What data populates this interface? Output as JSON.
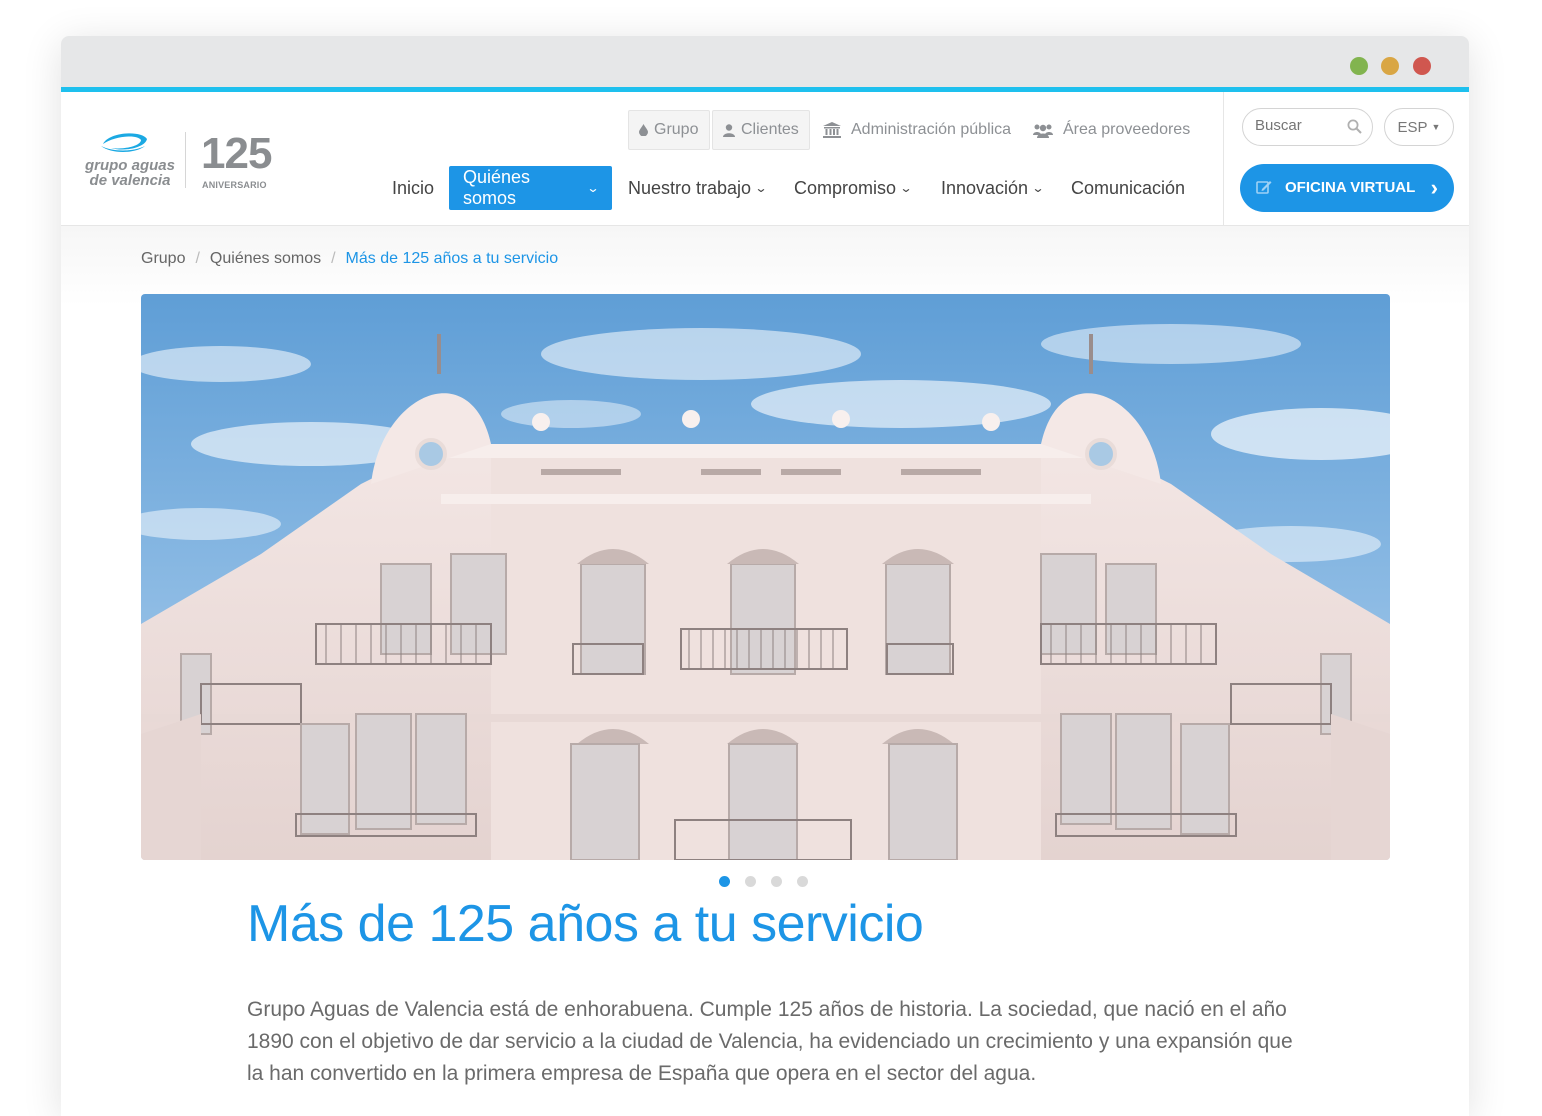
{
  "window": {
    "controls": [
      {
        "name": "minimize",
        "color": "#82b44f"
      },
      {
        "name": "zoom",
        "color": "#d9a644"
      },
      {
        "name": "close",
        "color": "#d0574f"
      }
    ]
  },
  "logo": {
    "line1": "grupo aguas",
    "line2": "de valencia",
    "anniversary_number": "125",
    "anniversary_label": "ANIVERSARIO"
  },
  "top_links": [
    {
      "label": "Grupo",
      "icon": "drop-icon"
    },
    {
      "label": "Clientes",
      "icon": "user-icon"
    },
    {
      "label": "Administración pública",
      "icon": "bank-icon"
    },
    {
      "label": "Área proveedores",
      "icon": "users-icon"
    }
  ],
  "main_nav": [
    {
      "label": "Inicio",
      "has_dropdown": false,
      "active": false
    },
    {
      "label": "Quiénes somos",
      "has_dropdown": true,
      "active": true
    },
    {
      "label": "Nuestro trabajo",
      "has_dropdown": true,
      "active": false
    },
    {
      "label": "Compromiso",
      "has_dropdown": true,
      "active": false
    },
    {
      "label": "Innovación",
      "has_dropdown": true,
      "active": false
    },
    {
      "label": "Comunicación",
      "has_dropdown": false,
      "active": false
    }
  ],
  "search": {
    "placeholder": "Buscar"
  },
  "language": {
    "selected": "ESP"
  },
  "cta": {
    "label": "OFICINA VIRTUAL"
  },
  "breadcrumb": [
    "Grupo",
    "Quiénes somos",
    "Más de 125 años a tu servicio"
  ],
  "carousel": {
    "slides": 4,
    "active_index": 0
  },
  "page": {
    "title": "Más de 125 años a tu servicio",
    "intro": "Grupo Aguas de Valencia está de enhorabuena. Cumple 125 años de historia. La sociedad, que nació en el año 1890 con el objetivo de dar servicio a la ciudad de Valencia, ha evidenciado un crecimiento y una expansión que la han convertido en la primera empresa de España que opera en el sector del agua."
  },
  "colors": {
    "accent": "#1d95e6",
    "topbar_stripe": "#1ec0ee",
    "logo_grey": "#8a8d90"
  }
}
